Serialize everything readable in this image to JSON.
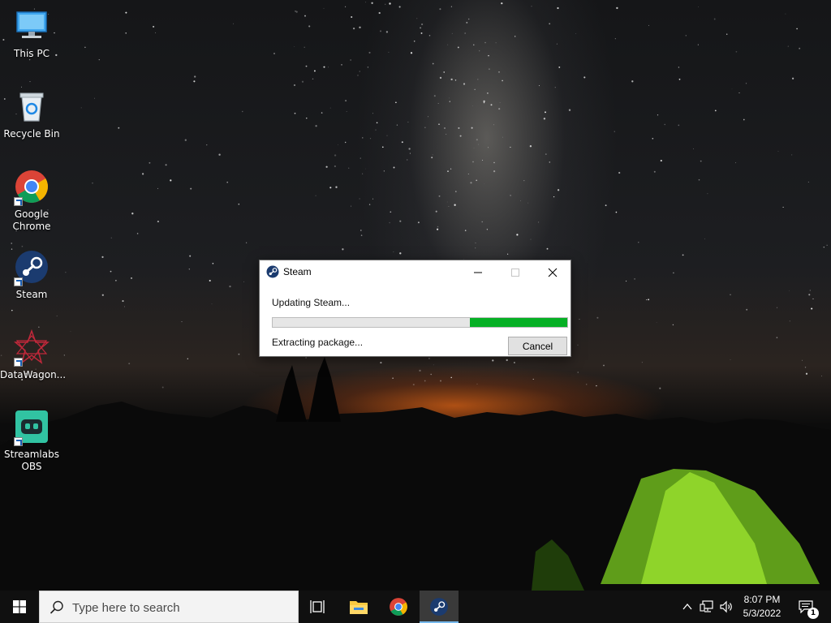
{
  "desktop": {
    "icons": [
      {
        "label": "This PC",
        "icon": "this-pc-icon"
      },
      {
        "label": "Recycle Bin",
        "icon": "recycle-bin-icon"
      },
      {
        "label": "Google Chrome",
        "icon": "chrome-icon"
      },
      {
        "label": "Steam",
        "icon": "steam-icon"
      },
      {
        "label": "DataWagon...",
        "icon": "datawagon-icon"
      },
      {
        "label": "Streamlabs OBS",
        "icon": "streamlabs-obs-icon"
      }
    ]
  },
  "dialog": {
    "title": "Steam",
    "status": "Updating Steam...",
    "substatus": "Extracting package...",
    "cancel_label": "Cancel",
    "progress_percent": 33,
    "progress_color": "#06b025"
  },
  "taskbar": {
    "search_placeholder": "Type here to search",
    "time": "8:07 PM",
    "date": "5/3/2022",
    "notification_count": "1"
  },
  "colors": {
    "taskbar_bg": "#101010",
    "accent": "#76b9ed"
  }
}
